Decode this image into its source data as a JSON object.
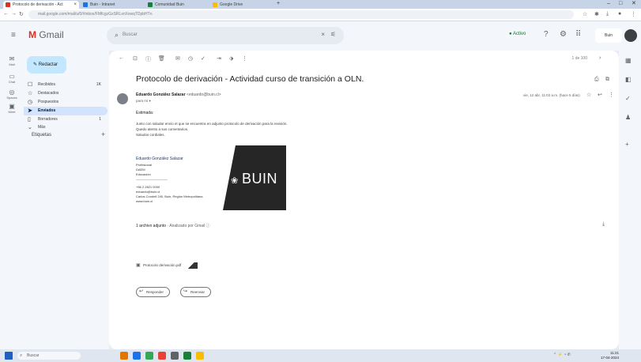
{
  "browser": {
    "tabs": [
      {
        "title": "Protocolo de derivación - Act",
        "active": true
      },
      {
        "title": "Buin - Intranet",
        "active": false
      },
      {
        "title": "Comunidad Buin",
        "active": false
      },
      {
        "title": "Google Drive",
        "active": false
      }
    ],
    "url": "mail.google.com/mail/u/0/#inbox/FMfcgzGxSRLxnXvwqTDpbHTn",
    "window_controls": [
      "–",
      "□",
      "✕"
    ]
  },
  "gmail": {
    "app_name": "Gmail",
    "search_placeholder": "Buscar",
    "status": "● Activo",
    "org_logo_text": "Buin"
  },
  "rail": [
    {
      "icon": "mail-icon",
      "label": "Mail"
    },
    {
      "icon": "chat-icon",
      "label": "Chat"
    },
    {
      "icon": "spaces-icon",
      "label": "Spaces"
    },
    {
      "icon": "meet-icon",
      "label": "Meet"
    }
  ],
  "sidebar": {
    "compose_label": "Redactar",
    "items": [
      {
        "label": "Recibidos",
        "count": "1K",
        "icon": "☐",
        "active": false
      },
      {
        "label": "Destacados",
        "count": "",
        "icon": "☆",
        "active": false
      },
      {
        "label": "Pospuestos",
        "count": "",
        "icon": "◷",
        "active": false
      },
      {
        "label": "Enviados",
        "count": "",
        "icon": "➤",
        "active": true
      },
      {
        "label": "Borradores",
        "count": "1",
        "icon": "▯",
        "active": false
      },
      {
        "label": "Más",
        "count": "",
        "icon": "⌄",
        "active": false
      }
    ],
    "labels_header": "Etiquetas"
  },
  "message": {
    "subject": "Protocolo de derivación - Actividad curso de transición a OLN.",
    "sender_name": "Eduardo González Salazar",
    "sender_addr": "<eduardo@buin.cl>",
    "to_line": "para mí ▾",
    "date": "vie, 12 abr, 11:02 a.m. (hace 5 días)",
    "greeting": "Estimada:",
    "body_lines": [
      "Junto con saludar envío el que se encuentra en adjunto protocolo de derivación para la revisión.",
      "Quedo atento a sus comentarios.",
      "Saludos cordiales."
    ],
    "signature": {
      "name": "Eduardo González Salazar",
      "lines": [
        "Profesional",
        "DAEM",
        "Educación",
        "——————————",
        "+56 2 2821 0000",
        "eduardo@buin.cl",
        "Carlos Condell 240, Buin, Región Metropolitana",
        "www.buin.cl"
      ],
      "logo_text": "BUIN"
    },
    "attachments_header": "1 archivo adjunto",
    "attachments_scan": "· Analizado por Gmail ⓘ",
    "attachment_name": "Protocolo derivación.pdf",
    "reply_label": "Responder",
    "forward_label": "Reenviar",
    "pager": "1 de 100"
  },
  "taskbar": {
    "search_label": "Buscar",
    "time": "11:21",
    "date": "17-04-2024"
  }
}
